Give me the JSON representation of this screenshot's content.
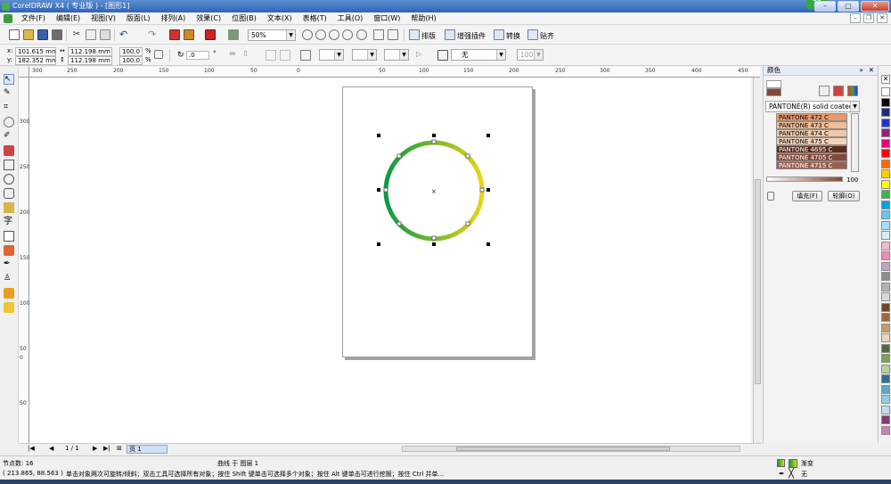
{
  "title_bar": {
    "title": "CorelDRAW X4 ( 专业版 ) - [图形1]",
    "badge": "73"
  },
  "menu": [
    "文件(F)",
    "编辑(E)",
    "视图(V)",
    "版面(L)",
    "排列(A)",
    "效果(C)",
    "位图(B)",
    "文本(X)",
    "表格(T)",
    "工具(O)",
    "窗口(W)",
    "帮助(H)"
  ],
  "toolbar": {
    "zoom": "50%",
    "buttons": [
      "排版",
      "增强插件",
      "转换",
      "贴齐"
    ]
  },
  "property_bar": {
    "x": "101.615 mm",
    "y": "182.352 mm",
    "width": "112.198 mm",
    "height": "112.198 mm",
    "scale_w": "100.0",
    "scale_h": "100.0",
    "percent": "%",
    "angle": ".0",
    "degree": "°",
    "outline": "无",
    "fill_value": "100"
  },
  "ruler_h_ticks": [
    "300",
    "250",
    "200",
    "150",
    "100",
    "50",
    "0",
    "50",
    "100",
    "150",
    "200",
    "250",
    "300",
    "350",
    "400",
    "450"
  ],
  "ruler_v_ticks": [
    "300",
    "250",
    "200",
    "150",
    "100",
    "50",
    "0",
    "50"
  ],
  "page_nav": {
    "current": "1 / 1",
    "tab": "页 1"
  },
  "status": {
    "node_count": "节点数: 16",
    "object_info": "曲线 于 图层 1",
    "coords": "( 213.865, 88.563 )",
    "hint": "单击对象两次可旋转/倾斜；双击工具可选择所有对象；按住 Shift 键单击可选择多个对象；按住 Alt 键单击可进行挖掘；按住 Ctrl 并单...",
    "fill_label": "渐变",
    "outline_label": "无"
  },
  "color_panel": {
    "title": "颜色",
    "palette_name": "PANTONE(R) solid coated",
    "swatches": [
      {
        "name": "PANTONE 472 C",
        "color": "#e8996c"
      },
      {
        "name": "PANTONE 473 C",
        "color": "#efbd97"
      },
      {
        "name": "PANTONE 474 C",
        "color": "#f0c9a6"
      },
      {
        "name": "PANTONE 475 C",
        "color": "#f2d3b8"
      },
      {
        "name": "PANTONE 4695 C",
        "color": "#5c2a1e"
      },
      {
        "name": "PANTONE 4705 C",
        "color": "#83483a"
      },
      {
        "name": "PANTONE 4715 C",
        "color": "#9a5f4e"
      }
    ],
    "tint": "100",
    "fill_button": "填充(F)",
    "outline_button": "轮廓(O)"
  },
  "ring_gradient": {
    "start": "#0a9b45",
    "end": "#e8d417"
  },
  "right_palette": [
    "#ffffff",
    "#000000",
    "#1b2c86",
    "#2033c8",
    "#9a1f74",
    "#e2007a",
    "#ff0000",
    "#ff6a00",
    "#ffcc00",
    "#ffff00",
    "#3db54a",
    "#00a0e3",
    "#6cc4ef",
    "#a6dff7",
    "#d7eef9",
    "#f4b9c7",
    "#f08cb5",
    "#c2a0c9",
    "#8c8c8c",
    "#b3b3b3",
    "#d9d9d9",
    "#6e4a2b",
    "#a0683b",
    "#c49a6c",
    "#e9d8b9",
    "#4a6d3b",
    "#7ea35c",
    "#b7d099",
    "#2f6e8c",
    "#5fa7c8",
    "#94cde2",
    "#c0dde8",
    "#7f3a76",
    "#c481b7"
  ]
}
